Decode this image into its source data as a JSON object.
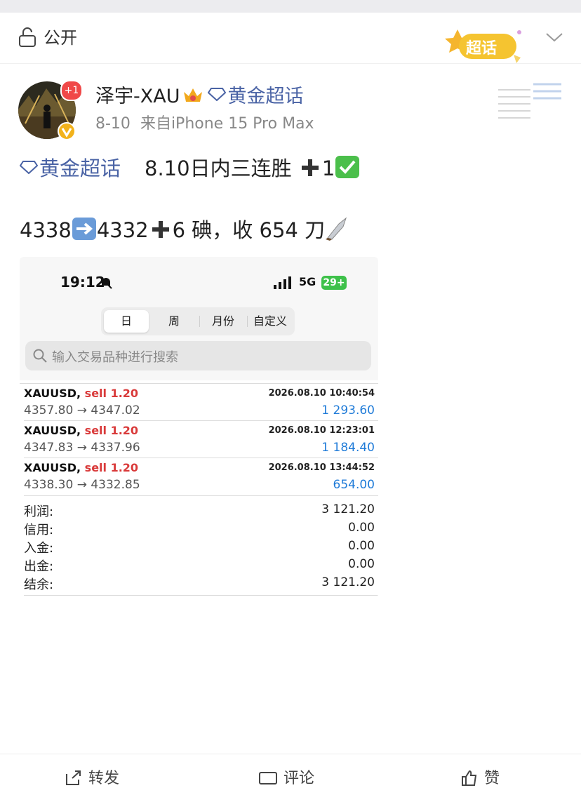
{
  "visibility": {
    "label": "公开"
  },
  "badge": {
    "text": "超话"
  },
  "author": {
    "name": "泽宇-XAU",
    "topic": "黄金超话",
    "notification": "+1",
    "date": "8-10",
    "source": "来自iPhone 15 Pro Max"
  },
  "post": {
    "topic": "黄金超话",
    "line1_text": "8.10日内三连胜",
    "line1_suffix": "1",
    "line2_a": "4338",
    "line2_b": "4332",
    "line2_c": "6 碘，收 654 刀"
  },
  "screenshot": {
    "status": {
      "time": "19:12",
      "network": "5G",
      "battery": "29+"
    },
    "tabs": [
      "日",
      "周",
      "月份",
      "自定义"
    ],
    "search_placeholder": "输入交易品种进行搜索",
    "trades": [
      {
        "symbol": "XAUUSD,",
        "side": "sell 1.20",
        "time": "2026.08.10 10:40:54",
        "prices": "4357.80 → 4347.02",
        "profit": "1 293.60"
      },
      {
        "symbol": "XAUUSD,",
        "side": "sell 1.20",
        "time": "2026.08.10 12:23:01",
        "prices": "4347.83 → 4337.96",
        "profit": "1 184.40"
      },
      {
        "symbol": "XAUUSD,",
        "side": "sell 1.20",
        "time": "2026.08.10 13:44:52",
        "prices": "4338.30 → 4332.85",
        "profit": "654.00"
      }
    ],
    "summary": [
      {
        "label": "利润:",
        "value": "3 121.20"
      },
      {
        "label": "信用:",
        "value": "0.00"
      },
      {
        "label": "入金:",
        "value": "0.00"
      },
      {
        "label": "出金:",
        "value": "0.00"
      },
      {
        "label": "结余:",
        "value": "3 121.20"
      }
    ]
  },
  "actions": {
    "repost": "转发",
    "comment": "评论",
    "like": "赞"
  },
  "colors": {
    "topic": "#4a63a5",
    "profit": "#1f7bd8",
    "sell": "#d93a3a",
    "badge": "#f5c430"
  }
}
